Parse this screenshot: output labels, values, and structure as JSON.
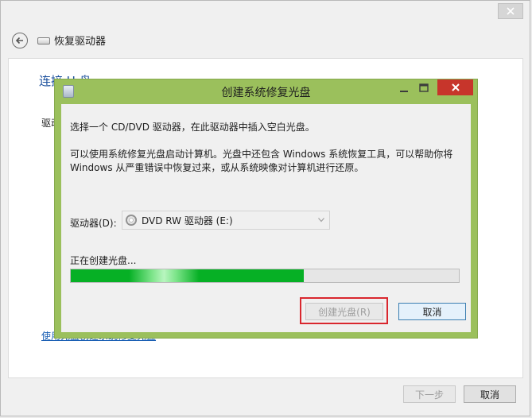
{
  "outer": {
    "title": "恢复驱动器",
    "section_title": "连接 U 盘",
    "drive_label_partial": "驱动器",
    "link_partial": "使用光盘创建系统修复光盘",
    "next_button": "下一步",
    "cancel_button": "取消"
  },
  "dialog": {
    "title": "创建系统修复光盘",
    "instruction": "选择一个 CD/DVD 驱动器，在此驱动器中插入空白光盘。",
    "description": "可以使用系统修复光盘启动计算机。光盘中还包含 Windows 系统恢复工具，可以帮助你将 Windows 从严重错误中恢复过来，或从系统映像对计算机进行还原。",
    "drive_label": "驱动器(D):",
    "drive_value": "DVD RW 驱动器 (E:)",
    "status": "正在创建光盘...",
    "progress_percent": 60,
    "create_button": "创建光盘(R)",
    "cancel_button": "取消"
  },
  "colors": {
    "dialog_frame": "#9bc05c",
    "close_button": "#c7352b",
    "progress": "#06b025",
    "highlight": "#d9272e",
    "link": "#1a5fb4"
  }
}
